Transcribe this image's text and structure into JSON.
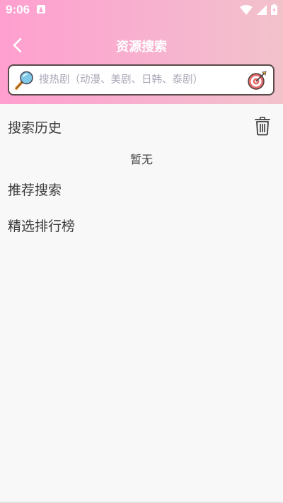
{
  "status_bar": {
    "time": "9:06"
  },
  "header": {
    "title": "资源搜索"
  },
  "search": {
    "placeholder": "搜热剧（动漫、美剧、日韩、泰剧）",
    "value": ""
  },
  "history": {
    "title": "搜索历史",
    "empty_text": "暂无"
  },
  "recommend": {
    "title": "推荐搜索"
  },
  "ranking": {
    "title": "精选排行榜"
  },
  "colors": {
    "header_gradient_start": "#ff9fcf",
    "header_gradient_end": "#f2c2cb",
    "background": "#f8f8f8"
  }
}
